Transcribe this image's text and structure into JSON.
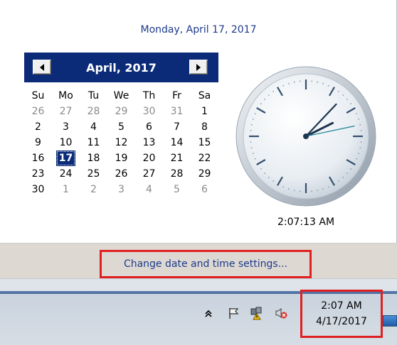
{
  "flyout": {
    "long_date": "Monday, April 17, 2017",
    "calendar": {
      "month_title": "April, 2017",
      "prev_icon": "arrow-left-icon",
      "next_icon": "arrow-right-icon",
      "weekdays": [
        "Su",
        "Mo",
        "Tu",
        "We",
        "Th",
        "Fr",
        "Sa"
      ],
      "weeks": [
        [
          {
            "d": "26",
            "o": true
          },
          {
            "d": "27",
            "o": true
          },
          {
            "d": "28",
            "o": true
          },
          {
            "d": "29",
            "o": true
          },
          {
            "d": "30",
            "o": true
          },
          {
            "d": "31",
            "o": true
          },
          {
            "d": "1",
            "o": false
          }
        ],
        [
          {
            "d": "2",
            "o": false
          },
          {
            "d": "3",
            "o": false
          },
          {
            "d": "4",
            "o": false
          },
          {
            "d": "5",
            "o": false
          },
          {
            "d": "6",
            "o": false
          },
          {
            "d": "7",
            "o": false
          },
          {
            "d": "8",
            "o": false
          }
        ],
        [
          {
            "d": "9",
            "o": false
          },
          {
            "d": "10",
            "o": false
          },
          {
            "d": "11",
            "o": false
          },
          {
            "d": "12",
            "o": false
          },
          {
            "d": "13",
            "o": false
          },
          {
            "d": "14",
            "o": false
          },
          {
            "d": "15",
            "o": false
          }
        ],
        [
          {
            "d": "16",
            "o": false
          },
          {
            "d": "17",
            "o": false,
            "today": true
          },
          {
            "d": "18",
            "o": false
          },
          {
            "d": "19",
            "o": false
          },
          {
            "d": "20",
            "o": false
          },
          {
            "d": "21",
            "o": false
          },
          {
            "d": "22",
            "o": false
          }
        ],
        [
          {
            "d": "23",
            "o": false
          },
          {
            "d": "24",
            "o": false
          },
          {
            "d": "25",
            "o": false
          },
          {
            "d": "26",
            "o": false
          },
          {
            "d": "27",
            "o": false
          },
          {
            "d": "28",
            "o": false
          },
          {
            "d": "29",
            "o": false
          }
        ],
        [
          {
            "d": "30",
            "o": false
          },
          {
            "d": "1",
            "o": true
          },
          {
            "d": "2",
            "o": true
          },
          {
            "d": "3",
            "o": true
          },
          {
            "d": "4",
            "o": true
          },
          {
            "d": "5",
            "o": true
          },
          {
            "d": "6",
            "o": true
          }
        ]
      ]
    },
    "clock": {
      "time_text": "2:07:13 AM",
      "hour": 2,
      "minute": 7,
      "second": 13
    },
    "change_settings_link": "Change date and time settings..."
  },
  "taskbar": {
    "tray_icons": [
      "chevron-up-icon",
      "action-center-flag-icon",
      "network-warning-icon",
      "speaker-muted-icon"
    ],
    "tray_time": "2:07 AM",
    "tray_date": "4/17/2017"
  },
  "colors": {
    "calendar_header": "#0b2b78",
    "link_blue": "#1d3a8c",
    "highlight_red": "#e02020"
  }
}
